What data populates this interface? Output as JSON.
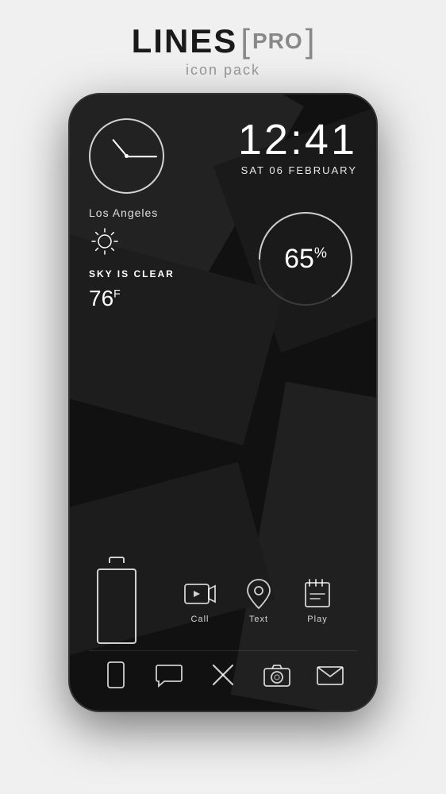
{
  "header": {
    "title_lines": "LINES",
    "title_bracket_open": "[",
    "title_pro": "PRO",
    "title_bracket_close": "]",
    "subtitle": "icon pack"
  },
  "clock": {
    "time": "12:41",
    "date": "SAT 06 FEBRUARY"
  },
  "weather": {
    "city": "Los Angeles",
    "condition": "SKY IS CLEAR",
    "temperature": "76",
    "temp_unit": "F"
  },
  "battery": {
    "percentage": "65",
    "percent_symbol": "%"
  },
  "quick_icons": [
    {
      "label": "Call",
      "icon": "phone-icon"
    },
    {
      "label": "Text",
      "icon": "text-icon"
    },
    {
      "label": "Play",
      "icon": "play-icon"
    }
  ],
  "dock_icons": [
    "phone-dock-icon",
    "chat-dock-icon",
    "close-dock-icon",
    "camera-dock-icon",
    "mail-dock-icon"
  ],
  "colors": {
    "background": "#f0f0f0",
    "phone_bg": "#111111",
    "text_white": "#ffffff",
    "text_gray": "#888888",
    "accent": "#1a1a1a"
  }
}
